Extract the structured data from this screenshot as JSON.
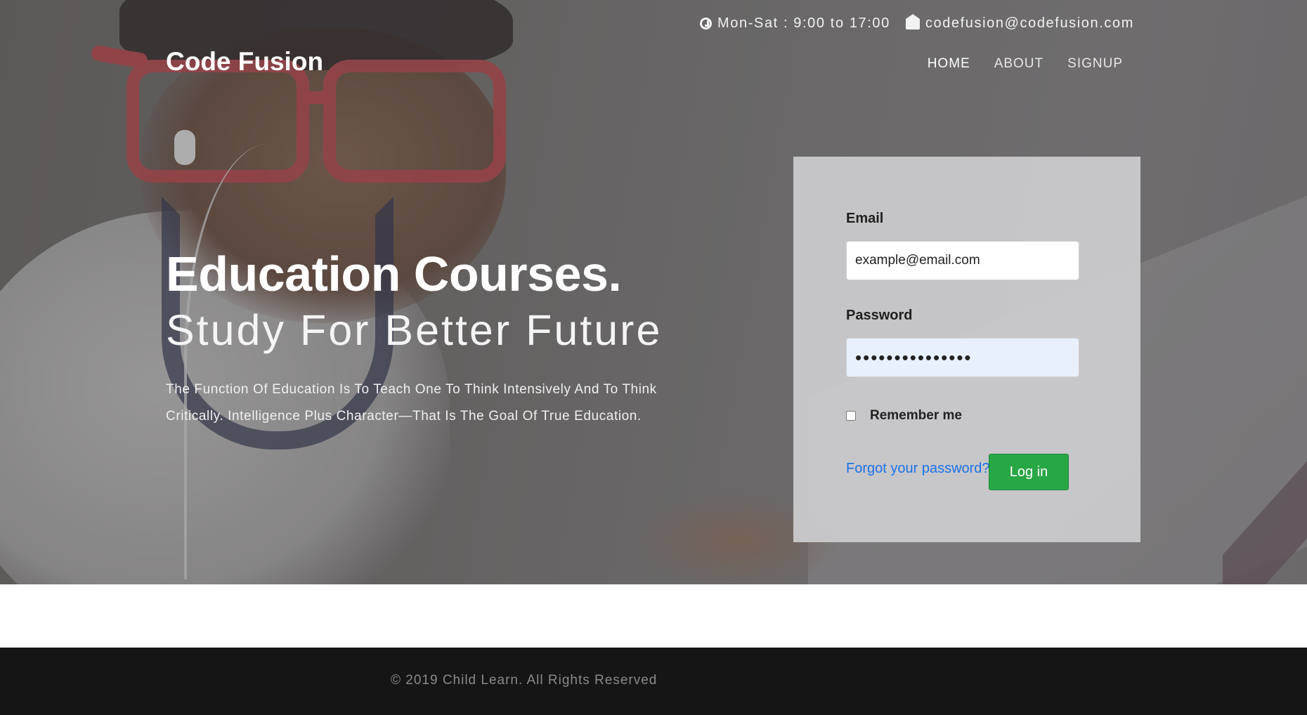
{
  "topbar": {
    "hours": "Mon-Sat : 9:00 to 17:00",
    "email": "codefusion@codefusion.com"
  },
  "brand": "Code Fusion",
  "nav": {
    "items": [
      {
        "label": "HOME",
        "active": true
      },
      {
        "label": "ABOUT",
        "active": false
      },
      {
        "label": "SIGNUP",
        "active": false
      }
    ]
  },
  "hero": {
    "title": "Education Courses.",
    "subtitle": "Study For Better Future",
    "description": "The Function Of Education Is To Teach One To Think Intensively And To Think Critically. Intelligence Plus Character—That Is The Goal Of True Education."
  },
  "login": {
    "email_label": "Email",
    "email_value": "example@email.com",
    "password_label": "Password",
    "password_value": "•••••••••••••••",
    "remember_label": "Remember me",
    "remember_checked": false,
    "forgot_label": "Forgot your password?",
    "submit_label": "Log in"
  },
  "footer": {
    "copyright": "© 2019 Child Learn. All Rights Reserved"
  },
  "colors": {
    "accent_green": "#28a745",
    "link_blue": "#1a73e8",
    "footer_bg": "#151515",
    "glasses_red": "#c44a4e"
  }
}
